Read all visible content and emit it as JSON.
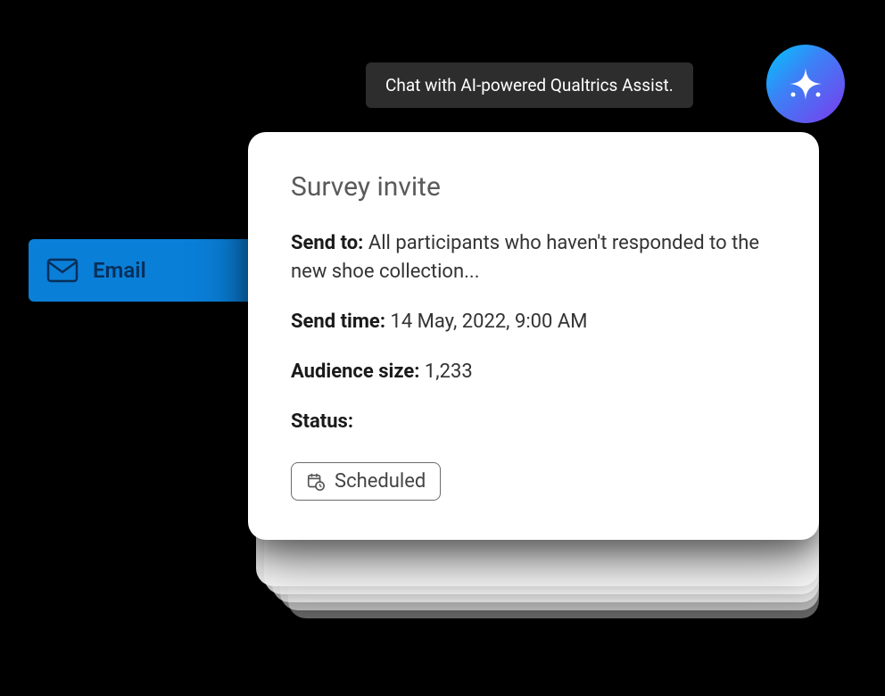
{
  "tooltip": {
    "text": "Chat with AI-powered Qualtrics Assist."
  },
  "sparkle": {
    "name": "assist-sparkle-icon"
  },
  "emailTab": {
    "label": "Email",
    "iconName": "mail-icon"
  },
  "card": {
    "title": "Survey invite",
    "fields": {
      "sendTo": {
        "label": "Send to:",
        "value": "All participants who haven't responded to the new shoe collection..."
      },
      "sendTime": {
        "label": "Send time:",
        "value": "14 May, 2022, 9:00 AM"
      },
      "audienceSize": {
        "label": "Audience size:",
        "value": "1,233"
      },
      "status": {
        "label": "Status:",
        "chip": "Scheduled",
        "chipIcon": "calendar-clock-icon"
      }
    }
  }
}
